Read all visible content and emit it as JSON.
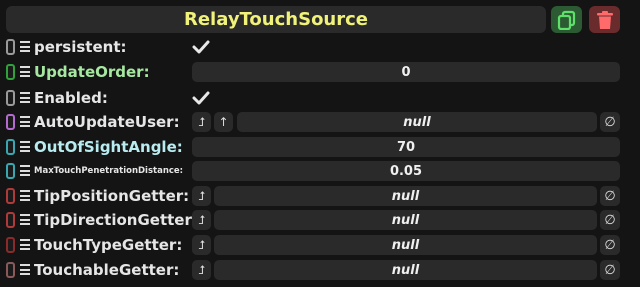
{
  "header": {
    "title": "RelayTouchSource"
  },
  "rows": [
    {
      "label": "persistent:",
      "label_color": "#e6e6e6",
      "pill_color": "#9a9a9a"
    },
    {
      "label": "UpdateOrder:",
      "label_color": "#a6e8a0",
      "pill_color": "#2fa33a",
      "value": "0"
    },
    {
      "label": "Enabled:",
      "label_color": "#e6e6e6",
      "pill_color": "#9a9a9a"
    },
    {
      "label": "AutoUpdateUser:",
      "label_color": "#e6e6e6",
      "pill_color": "#b46ad0",
      "value": "null"
    },
    {
      "label": "OutOfSightAngle:",
      "label_color": "#b8ecf0",
      "pill_color": "#3aa6b0",
      "value": "70"
    },
    {
      "label": "MaxTouchPenetrationDistance:",
      "label_color": "#e6e6e6",
      "pill_color": "#3aa6b0",
      "value": "0.05"
    },
    {
      "label": "TipPositionGetter:",
      "label_color": "#e6e6e6",
      "pill_color": "#b03a3a",
      "value": "null"
    },
    {
      "label": "TipDirectionGetter:",
      "label_color": "#e6e6e6",
      "pill_color": "#b03a3a",
      "value": "null"
    },
    {
      "label": "TouchTypeGetter:",
      "label_color": "#e6e6e6",
      "pill_color": "#8a2a2a",
      "value": "null"
    },
    {
      "label": "TouchableGetter:",
      "label_color": "#e6e6e6",
      "pill_color": "#8a5a5a",
      "value": "null"
    }
  ],
  "icons": {
    "duplicate": "duplicate-icon",
    "delete": "trash-icon",
    "check": "checkmark-icon",
    "jump": "jump-arrow-icon",
    "up": "up-arrow-icon",
    "null": "null-symbol-icon"
  },
  "symbols": {
    "null_glyph": "∅",
    "up_glyph": "↑",
    "jump_glyph": "⮥"
  },
  "colors": {
    "title": "#f0f27a",
    "duplicate_bg": "#2c5a33",
    "delete_bg": "#6a2b2d",
    "field_bg": "#2a2a2a",
    "background": "#141414"
  }
}
